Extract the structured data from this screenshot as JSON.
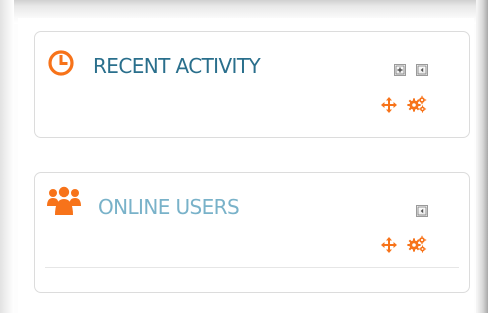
{
  "blocks": {
    "recent_activity": {
      "title": "RECENT ACTIVITY",
      "icon": "clock-icon",
      "controls": [
        "dock-block-icon",
        "collapse-block-icon"
      ],
      "actions": [
        "move-icon",
        "configure-icon"
      ]
    },
    "online_users": {
      "title": "ONLINE USERS",
      "icon": "users-icon",
      "controls": [
        "collapse-block-icon"
      ],
      "actions": [
        "move-icon",
        "configure-icon"
      ]
    }
  },
  "colors": {
    "accent_orange": "#f7731a",
    "title_dark_blue": "#2a6f8c",
    "title_light_blue": "#79b2c9",
    "block_border": "#dcdcdc"
  }
}
